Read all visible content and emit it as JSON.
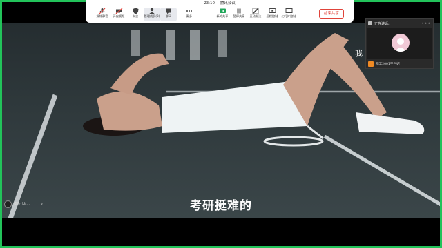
{
  "meeting": {
    "time": "23:10",
    "app_title": "腾讯会议"
  },
  "toolbar": {
    "left_buttons": [
      {
        "label": "解除静音",
        "icon": "mic-muted-icon"
      },
      {
        "label": "开启视频",
        "icon": "camera-off-icon"
      },
      {
        "label": "安全",
        "icon": "shield-icon"
      },
      {
        "label": "管理成员(3)",
        "icon": "members-icon"
      },
      {
        "label": "聊天",
        "icon": "chat-icon"
      },
      {
        "label": "更多",
        "icon": "more-icon"
      }
    ],
    "right_buttons": [
      {
        "label": "新的共享",
        "icon": "new-share-icon"
      },
      {
        "label": "暂停共享",
        "icon": "pause-share-icon"
      },
      {
        "label": "互动批注",
        "icon": "annotate-icon"
      },
      {
        "label": "远程控制",
        "icon": "remote-control-icon"
      },
      {
        "label": "幻灯片控制",
        "icon": "slides-icon"
      }
    ],
    "end_share_label": "结束共享"
  },
  "video": {
    "subtitle": "考研挺难的",
    "corner_text": "我",
    "mini_control_text": "电你什么…"
  },
  "participant_panel": {
    "header_name": "正在讲话:",
    "participant_name": "网工2001宁世妃"
  },
  "colors": {
    "share_border": "#22c35a",
    "end_share": "#e0443b",
    "mic_badge": "#f08a24"
  }
}
